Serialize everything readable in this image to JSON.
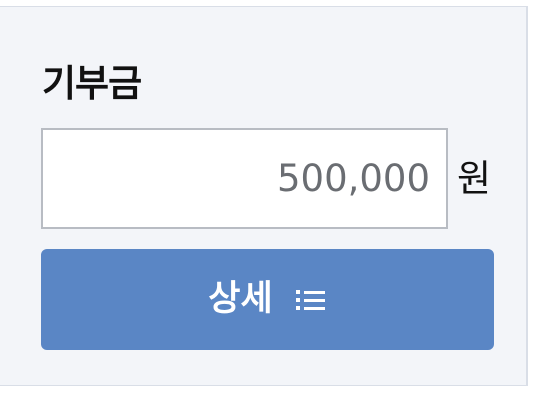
{
  "donation": {
    "label": "기부금",
    "amount_value": "500,000",
    "unit": "원",
    "detail_button_label": "상세",
    "detail_icon": "list-icon",
    "button_color": "#5a86c5",
    "panel_color": "#f3f5f9"
  }
}
